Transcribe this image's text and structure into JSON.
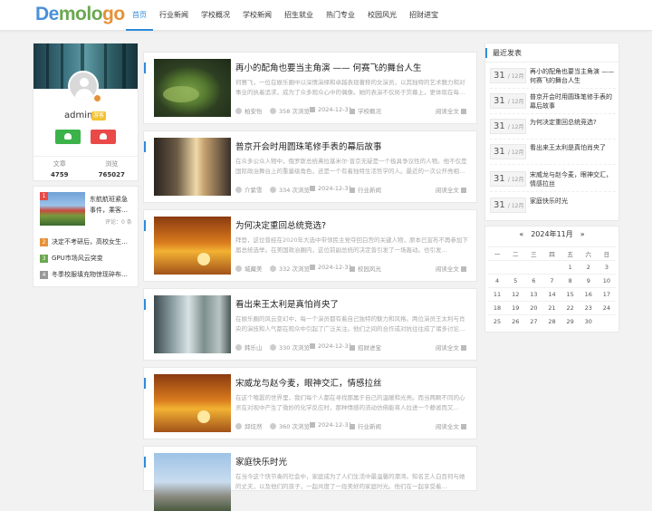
{
  "header": {
    "logo_parts": [
      "De",
      "molo",
      "go"
    ],
    "nav": [
      "首页",
      "行业新闻",
      "学校概况",
      "学校新闻",
      "招生就业",
      "热门专业",
      "校园风光",
      "招财进宝"
    ],
    "active_nav": 0
  },
  "profile": {
    "username": "admin",
    "badge": "游客",
    "stats": [
      {
        "label": "文章",
        "value": "4759"
      },
      {
        "label": "浏览",
        "value": "765027"
      }
    ]
  },
  "hot": {
    "top": {
      "rank": "1",
      "title": "东航航班紧急事件，乘客…",
      "views": "评论：0 条"
    },
    "items": [
      {
        "rank": "2",
        "title": "决定不考研后，高校女生…",
        "color": "#e69138"
      },
      {
        "rank": "3",
        "title": "GPU市场风云突变",
        "color": "#6aa84f"
      },
      {
        "rank": "4",
        "title": "冬季校服填充物惊现碎布…",
        "color": "#999999"
      }
    ]
  },
  "posts": [
    {
      "title": "再小的配角也要当主角演 —— 何赛飞的舞台人生",
      "desc": "何赛飞，一位在娱乐圈中以深情演绎和卓越表现著称的女演员，以其独特的艺术魅力和对事业的执着追求，成为了众多观众心中的偶像。她的表演不仅局于荧幕上，更体现在每…",
      "author": "柏安怡",
      "views": "358 次浏览",
      "date": "2024-12-31",
      "category": "学校概况",
      "more": "阅读全文"
    },
    {
      "title": "普京开会时用圆珠笔修手表的幕后故事",
      "desc": "在众多公众人物中，俄罗斯总统弗拉基米尔·普京无疑是一个极具争议性的人物。他不仅是国际政治舞台上的重量级角色，还是一个有着独特生活哲学的人。最近的一次公开亮相…",
      "author": "介紫雪",
      "views": "334 次浏览",
      "date": "2024-12-31",
      "category": "行业新闻",
      "more": "阅读全文"
    },
    {
      "title": "为何决定重回总统竞选?",
      "desc": "拜登，这位曾经在2020年大选中带领民主党夺回白宫的关键人物，原本已宣布不再参加下届总统选举。在美国政治圈内，这位前副总统的决定曾引发了一场轰动。也引发…",
      "author": "城藏美",
      "views": "332 次浏览",
      "date": "2024-12-31",
      "category": "校园风光",
      "more": "阅读全文"
    },
    {
      "title": "看出来王太利是真怕肖央了",
      "desc": "在娱乐圈的风云变幻中，每一个演员都有着自己独特的魅力和风格。两位演员王太利与肖央的演技和人气都在观众中引起了广泛关注。他们之间的合作或对抗往往成了诸多讨论…",
      "author": "韩乐山",
      "views": "330 次浏览",
      "date": "2024-12-31",
      "category": "招财进宝",
      "more": "阅读全文"
    },
    {
      "title": "宋威龙与赵今麦，眼神交汇，情感拉丝",
      "desc": "在这个喧嚣的世界里，我们每个人都在寻找那属于自己的温暖和光亮。而当两颗不同的心灵在对视中产生了微妙的化学反应时，那种情感的流动仿佛能将人拉进一个静谧而又…",
      "author": "邱炫然",
      "views": "360 次浏览",
      "date": "2024-12-31",
      "category": "行业新闻",
      "more": "阅读全文"
    },
    {
      "title": "家庭快乐时光",
      "desc": "在当今这个快节奏的社会中，家庭成为了人们生活中最温馨的港湾。知名艺人白百何与她的丈夫，以及他们的孩子，一起共度了一段美好的家庭时光。他们在一起享受着…",
      "author": "",
      "views": "",
      "date": "",
      "category": "",
      "more": ""
    }
  ],
  "recent": {
    "heading": "最近发表",
    "items": [
      {
        "day": "31",
        "month": "/ 12月",
        "title": "再小的配角也要当主角演 —— 何赛飞的舞台人生"
      },
      {
        "day": "31",
        "month": "/ 12月",
        "title": "普京开会时用圆珠笔修手表的幕后故事"
      },
      {
        "day": "31",
        "month": "/ 12月",
        "title": "为何决定重回总统竞选?"
      },
      {
        "day": "31",
        "month": "/ 12月",
        "title": "看出来王太利是真怕肖央了"
      },
      {
        "day": "31",
        "month": "/ 12月",
        "title": "宋威龙与赵今麦，眼神交汇，情感拉丝"
      },
      {
        "day": "31",
        "month": "/ 12月",
        "title": "家庭快乐时光"
      }
    ]
  },
  "calendar": {
    "prev": "«",
    "title": "2024年11月",
    "next": "»",
    "weekdays": [
      "一",
      "二",
      "三",
      "四",
      "五",
      "六",
      "日"
    ],
    "weeks": [
      [
        "",
        "",
        "",
        "",
        "1",
        "2",
        "3"
      ],
      [
        "4",
        "5",
        "6",
        "7",
        "8",
        "9",
        "10"
      ],
      [
        "11",
        "12",
        "13",
        "14",
        "15",
        "16",
        "17"
      ],
      [
        "18",
        "19",
        "20",
        "21",
        "22",
        "23",
        "24"
      ],
      [
        "25",
        "26",
        "27",
        "28",
        "29",
        "30",
        ""
      ]
    ]
  }
}
